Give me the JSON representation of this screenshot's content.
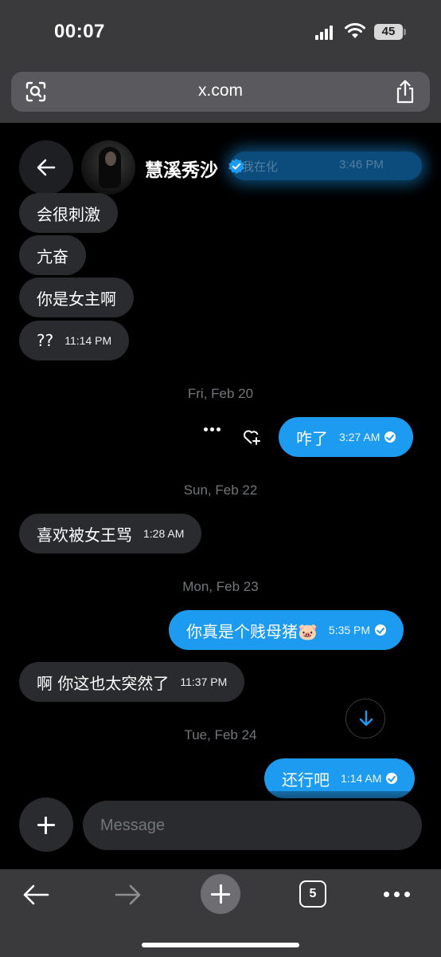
{
  "status_bar": {
    "time": "00:07",
    "battery": "45"
  },
  "browser": {
    "url": "x.com",
    "tab_count": "5"
  },
  "header": {
    "contact_name": "慧溪秀沙",
    "glow_text_left": "我在化",
    "glow_text_right": "3:46 PM"
  },
  "messages": [
    {
      "side": "in",
      "text": "会很刺激",
      "time": ""
    },
    {
      "side": "in",
      "text": "亢奋",
      "time": ""
    },
    {
      "side": "in",
      "text": "你是女主啊",
      "time": ""
    },
    {
      "side": "in",
      "text": "??",
      "time": "11:14 PM"
    },
    {
      "side": "out",
      "text": "咋了",
      "time": "3:27 AM"
    },
    {
      "side": "in",
      "text": "喜欢被女王骂",
      "time": "1:28 AM"
    },
    {
      "side": "out",
      "text": "你真是个贱母猪🐷",
      "time": "5:35 PM"
    },
    {
      "side": "in",
      "text": "啊 你这也太突然了",
      "time": "11:37 PM"
    },
    {
      "side": "out",
      "text": "还行吧",
      "time": "1:14 AM"
    }
  ],
  "date_separators": [
    "Fri, Feb 20",
    "Sun, Feb 22",
    "Mon, Feb 23",
    "Tue, Feb 24"
  ],
  "composer": {
    "placeholder": "Message"
  },
  "icons": {
    "back": "arrow-left-icon",
    "verified": "verified-badge-icon",
    "more": "more-horizontal-icon",
    "react": "heart-plus-icon",
    "scroll": "arrow-down-icon",
    "attach": "plus-icon"
  },
  "colors": {
    "accent": "#1d9bf0",
    "incoming_bubble": "#2a2b2f",
    "background": "#000000"
  }
}
